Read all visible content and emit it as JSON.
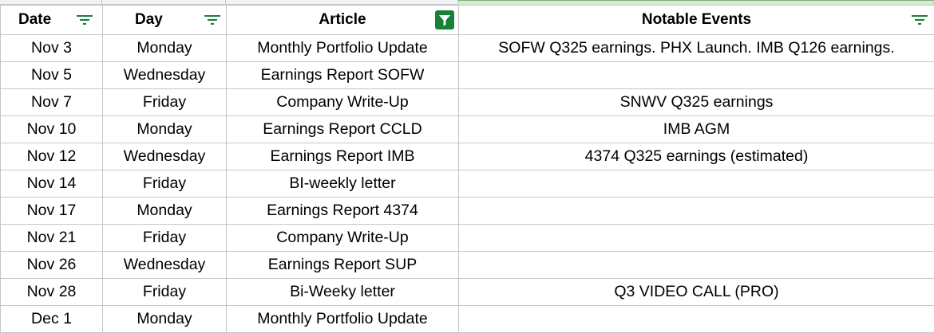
{
  "header": {
    "columns": [
      {
        "label": "Date",
        "filter_active": false
      },
      {
        "label": "Day",
        "filter_active": false
      },
      {
        "label": "Article",
        "filter_active": true
      },
      {
        "label": "Notable Events",
        "filter_active": false
      }
    ]
  },
  "colors": {
    "grid": "#c6c6c6",
    "filter_icon": "#188038",
    "active_filter_bg": "#188038",
    "selected_strip": "#d9ead3"
  },
  "icons": {
    "filter": "filter-lines-icon",
    "active_filter": "funnel-icon"
  },
  "rows": [
    {
      "date": "Nov 3",
      "day": "Monday",
      "article": "Monthly Portfolio Update",
      "events": "SOFW Q325 earnings. PHX Launch. IMB Q126 earnings."
    },
    {
      "date": "Nov 5",
      "day": "Wednesday",
      "article": "Earnings Report SOFW",
      "events": ""
    },
    {
      "date": "Nov 7",
      "day": "Friday",
      "article": "Company Write-Up",
      "events": "SNWV Q325 earnings"
    },
    {
      "date": "Nov 10",
      "day": "Monday",
      "article": "Earnings Report CCLD",
      "events": "IMB AGM"
    },
    {
      "date": "Nov 12",
      "day": "Wednesday",
      "article": "Earnings Report IMB",
      "events": "4374 Q325 earnings (estimated)"
    },
    {
      "date": "Nov 14",
      "day": "Friday",
      "article": "BI-weekly letter",
      "events": ""
    },
    {
      "date": "Nov 17",
      "day": "Monday",
      "article": "Earnings Report 4374",
      "events": ""
    },
    {
      "date": "Nov 21",
      "day": "Friday",
      "article": "Company Write-Up",
      "events": ""
    },
    {
      "date": "Nov 26",
      "day": "Wednesday",
      "article": "Earnings Report SUP",
      "events": ""
    },
    {
      "date": "Nov 28",
      "day": "Friday",
      "article": "Bi-Weeky letter",
      "events": "Q3 VIDEO CALL (PRO)"
    },
    {
      "date": "Dec 1",
      "day": "Monday",
      "article": "Monthly Portfolio Update",
      "events": ""
    }
  ]
}
